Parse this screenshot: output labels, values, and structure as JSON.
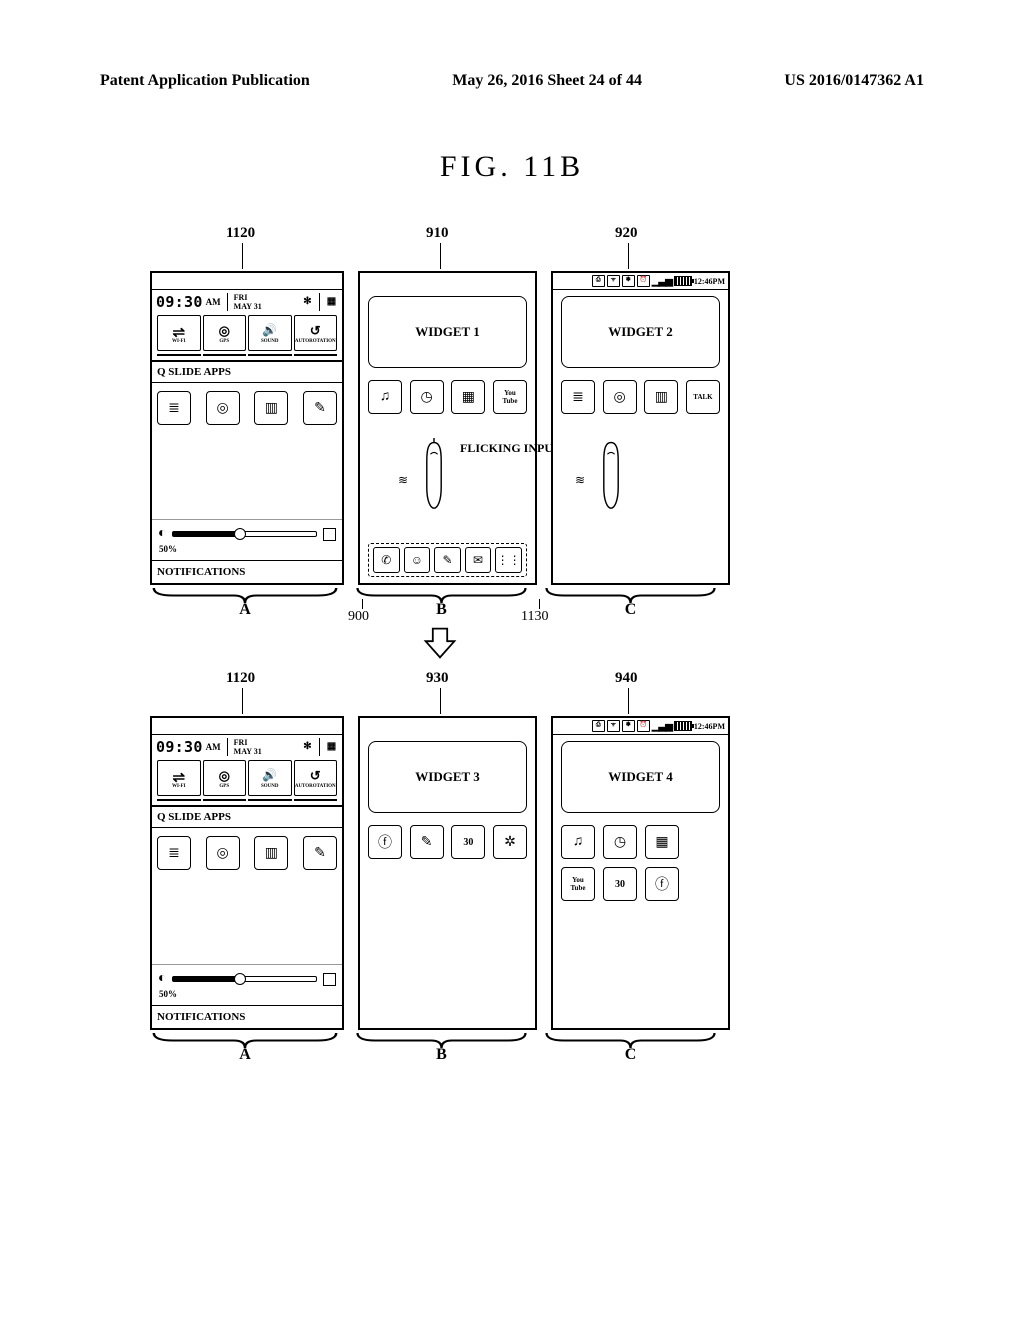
{
  "header": {
    "left": "Patent Application Publication",
    "center": "May 26, 2016  Sheet 24 of 44",
    "right": "US 2016/0147362 A1"
  },
  "figure_title": "FIG.  11B",
  "callouts_top": {
    "c1120": "1120",
    "c910": "910",
    "c920": "920"
  },
  "callouts_bottom": {
    "c1120": "1120",
    "c930": "930",
    "c940": "940"
  },
  "status": {
    "time": "12:46PM"
  },
  "panelA": {
    "clock": "09:30",
    "ampm": "AM",
    "day": "FRI",
    "date": "MAY 31",
    "toggles": [
      "WI-FI",
      "GPS",
      "SOUND",
      "AUTOROTATION"
    ],
    "qslide_label": "Q SLIDE APPS",
    "brightness_pct": "50%",
    "notifications_label": "NOTIFICATIONS"
  },
  "row1": {
    "B": {
      "widget": "WIDGET 1"
    },
    "C": {
      "widget": "WIDGET 2"
    }
  },
  "row2": {
    "B": {
      "widget": "WIDGET 3"
    },
    "C": {
      "widget": "WIDGET 4"
    }
  },
  "flick_label": "FLICKING INPUT",
  "yt_label_top": "You",
  "yt_label_bot": "Tube",
  "talk_label": "TALK",
  "cal_label": "30",
  "brace_labels": {
    "A": "A",
    "B": "B",
    "C": "C"
  },
  "side_numbers_row1": {
    "n900": "900",
    "n1130": "1130"
  }
}
